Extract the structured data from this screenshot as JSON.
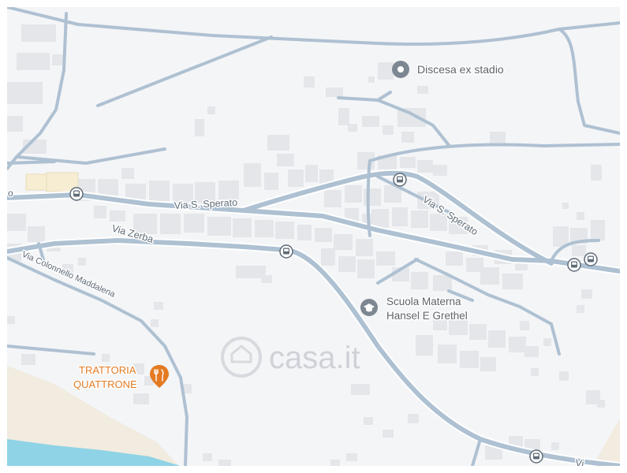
{
  "map": {
    "colors": {
      "background": "#f4f5f7",
      "road": "#aec1d2",
      "road_casing": "#ffffff",
      "building": "#e4e6ea",
      "water": "#8ed3e6",
      "sand": "#f1ebe0",
      "poi_food": "#e37a22",
      "poi_generic": "#7d8791",
      "bus_stop": "#5f6b78",
      "watermark": "#c8ccd1"
    },
    "streets": {
      "via_s_sperato_west": "Via S. Sperato",
      "via_s_sperato_east": "Via S. Sperato",
      "via_zerba": "Via Zerba",
      "via_colonnello_maddalena": "Via Colonnello Maddalena",
      "edge_left": "o",
      "edge_bottom": "Vi"
    },
    "pois": {
      "discesa": {
        "name": "Discesa ex stadio",
        "icon": "place-pin-icon"
      },
      "scuola": {
        "line1": "Scuola Materna",
        "line2": "Hansel E Grethel",
        "icon": "graduation-cap-icon"
      },
      "trattoria": {
        "line1": "TRATTORIA",
        "line2": "QUATTRONE",
        "icon": "fork-knife-icon"
      }
    },
    "bus_stops": {
      "icon": "bus-stop-icon",
      "count": 6
    },
    "watermark": {
      "text": "casa.it"
    }
  }
}
